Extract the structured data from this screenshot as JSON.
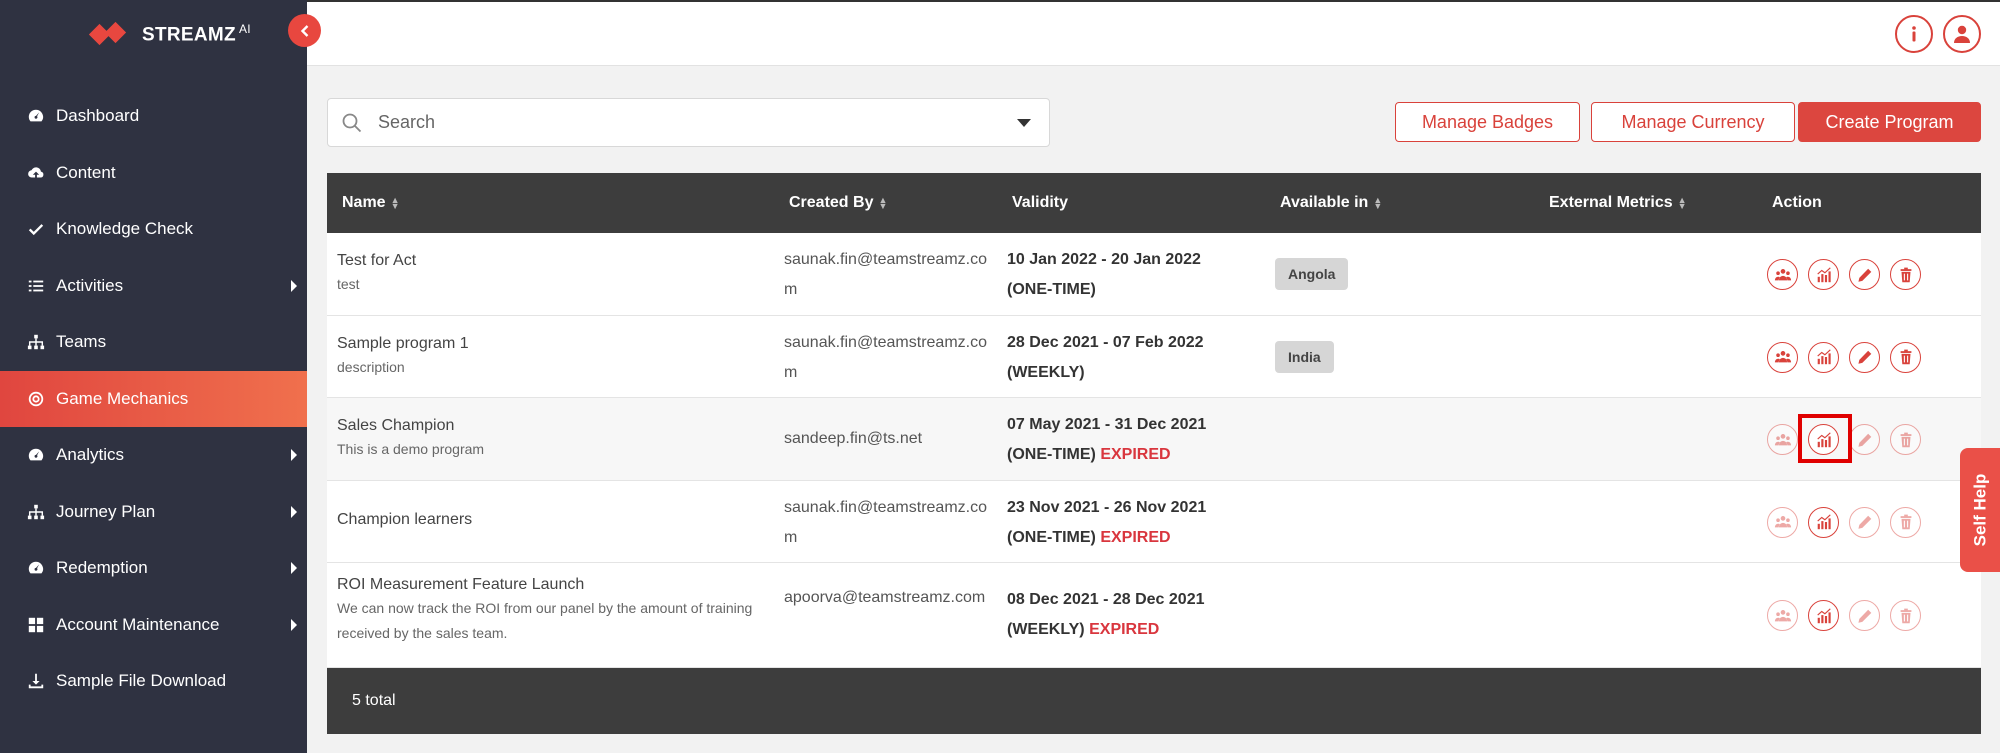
{
  "brand": {
    "name": "STREAMZ",
    "sup": "AI"
  },
  "sidebar": {
    "items": [
      {
        "label": "Dashboard",
        "icon": "dashboard-icon"
      },
      {
        "label": "Content",
        "icon": "cloud-upload-icon"
      },
      {
        "label": "Knowledge Check",
        "icon": "check-icon"
      },
      {
        "label": "Activities",
        "icon": "list-icon",
        "submenu": true
      },
      {
        "label": "Teams",
        "icon": "sitemap-icon"
      },
      {
        "label": "Game Mechanics",
        "icon": "target-icon",
        "active": true
      },
      {
        "label": "Analytics",
        "icon": "dashboard-icon",
        "submenu": true
      },
      {
        "label": "Journey Plan",
        "icon": "sitemap-icon",
        "submenu": true
      },
      {
        "label": "Redemption",
        "icon": "dashboard-icon",
        "submenu": true
      },
      {
        "label": "Account Maintenance",
        "icon": "grid-icon",
        "submenu": true
      },
      {
        "label": "Sample File Download",
        "icon": "download-icon"
      }
    ]
  },
  "search": {
    "placeholder": "Search"
  },
  "buttons": {
    "manage_badges": "Manage Badges",
    "manage_currency": "Manage Currency",
    "create_program": "Create Program"
  },
  "table": {
    "columns": {
      "name": "Name",
      "created_by": "Created By",
      "validity": "Validity",
      "available_in": "Available in",
      "external_metrics": "External Metrics",
      "action": "Action"
    },
    "rows": [
      {
        "name": "Test for Act",
        "description": "test",
        "created_by": "saunak.fin@teamstreamz.com",
        "validity_dates": "10 Jan 2022 - 20 Jan 2022",
        "validity_type": "(ONE-TIME)",
        "status": "",
        "available_in": "Angola"
      },
      {
        "name": "Sample program 1",
        "description": "description",
        "created_by": "saunak.fin@teamstreamz.com",
        "validity_dates": "28 Dec 2021 - 07 Feb 2022",
        "validity_type": "(WEEKLY)",
        "status": "",
        "available_in": "India"
      },
      {
        "name": "Sales Champion",
        "description": "This is a demo program",
        "created_by": "sandeep.fin@ts.net",
        "validity_dates": "07 May 2021 - 31 Dec 2021",
        "validity_type": "(ONE-TIME)",
        "status": "EXPIRED",
        "available_in": ""
      },
      {
        "name": "Champion learners",
        "description": "",
        "created_by": "saunak.fin@teamstreamz.com",
        "validity_dates": "23 Nov 2021 - 26 Nov 2021",
        "validity_type": "(ONE-TIME)",
        "status": "EXPIRED",
        "available_in": ""
      },
      {
        "name": "ROI Measurement Feature Launch",
        "description": "We can now track the ROI from our panel by the amount of training received by the sales team.",
        "created_by": "apoorva@teamstreamz.com",
        "validity_dates": "08 Dec 2021 - 28 Dec 2021",
        "validity_type": "(WEEKLY)",
        "status": "EXPIRED",
        "available_in": ""
      }
    ],
    "footer_total": "5 total"
  },
  "self_help": "Self Help",
  "colors": {
    "accent": "#d9423b",
    "sidebar_bg": "#2f3241",
    "table_header_bg": "#3d3d3d",
    "expired": "#d9363e"
  }
}
